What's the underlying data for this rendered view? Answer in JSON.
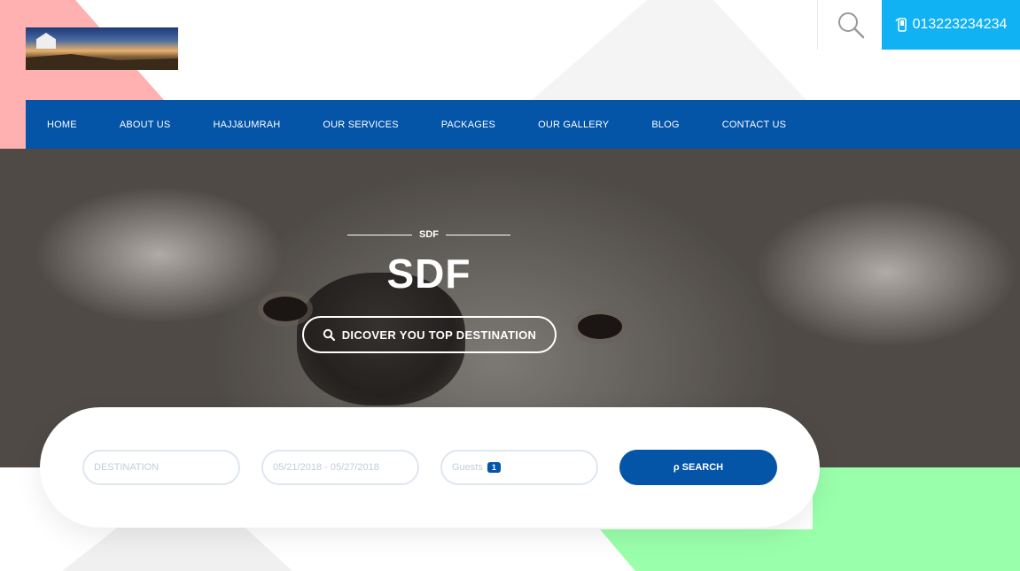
{
  "header": {
    "logo_alt": "site logo",
    "phone": "013223234234",
    "phone_icon": "phone-icon",
    "search_icon": "search-icon"
  },
  "nav": {
    "items": [
      {
        "label": "HOME"
      },
      {
        "label": "ABOUT US"
      },
      {
        "label": "HAJJ&UMRAH"
      },
      {
        "label": "OUR SERVICES"
      },
      {
        "label": "PACKAGES"
      },
      {
        "label": "OUR GALLERY"
      },
      {
        "label": "BLOG"
      },
      {
        "label": "CONTACT US"
      }
    ]
  },
  "hero": {
    "subtitle": "SDF",
    "title": "SDF",
    "button_label": "DICOVER YOU TOP DESTINATION",
    "button_icon": "search-icon"
  },
  "booking": {
    "destination_placeholder": "DESTINATION",
    "dates_value": "05/21/2018 - 05/27/2018",
    "guests_label": "Guests",
    "guests_count": "1",
    "search_label": "SEARCH",
    "search_glyph": "ρ"
  },
  "colors": {
    "nav_bg": "#0454a8",
    "phone_bg": "#10b2f4",
    "accent_pink": "#ffb0b0",
    "accent_green": "#9affab"
  }
}
